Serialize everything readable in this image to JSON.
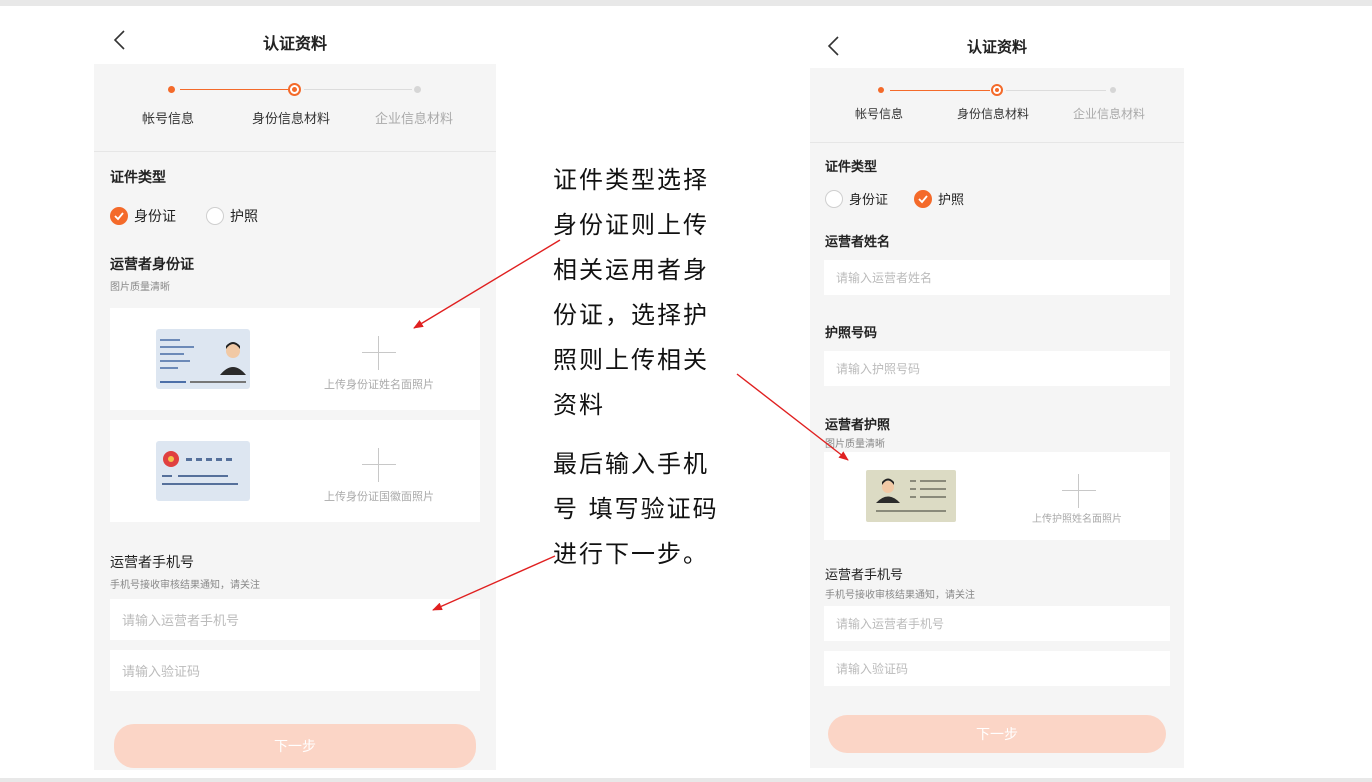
{
  "left": {
    "title": "认证资料",
    "steps": [
      "帐号信息",
      "身份信息材料",
      "企业信息材料"
    ],
    "cert_type_title": "证件类型",
    "radio_id": "身份证",
    "radio_passport": "护照",
    "idcard_title": "运营者身份证",
    "idcard_hint": "图片质量清晰",
    "upload_front": "上传身份证姓名面照片",
    "upload_back": "上传身份证国徽面照片",
    "phone_title": "运营者手机号",
    "phone_hint": "手机号接收审核结果通知，请关注",
    "phone_placeholder": "请输入运营者手机号",
    "code_placeholder": "请输入验证码",
    "next_button": "下一步"
  },
  "right": {
    "title": "认证资料",
    "steps": [
      "帐号信息",
      "身份信息材料",
      "企业信息材料"
    ],
    "cert_type_title": "证件类型",
    "radio_id": "身份证",
    "radio_passport": "护照",
    "name_title": "运营者姓名",
    "name_placeholder": "请输入运营者姓名",
    "passport_no_title": "护照号码",
    "passport_no_placeholder": "请输入护照号码",
    "passport_title": "运营者护照",
    "passport_hint": "图片质量清晰",
    "upload_passport": "上传护照姓名面照片",
    "phone_title": "运营者手机号",
    "phone_hint": "手机号接收审核结果通知，请关注",
    "phone_placeholder": "请输入运营者手机号",
    "code_placeholder": "请输入验证码",
    "next_button": "下一步"
  },
  "annotation": {
    "lines1": [
      "证件类型选择",
      "身份证则上传",
      "相关运用者身",
      "份证，选择护",
      "照则上传相关",
      "资料"
    ],
    "lines2": [
      "最后输入手机",
      "号 填写验证码",
      "进行下一步。"
    ]
  },
  "colors": {
    "accent": "#f46a2a",
    "button_disabled": "#fbd5c6",
    "arrow": "#e02020",
    "panel": "#f5f5f5"
  },
  "state": {
    "left_selected_cert": "身份证",
    "right_selected_cert": "护照",
    "active_step": 2
  }
}
